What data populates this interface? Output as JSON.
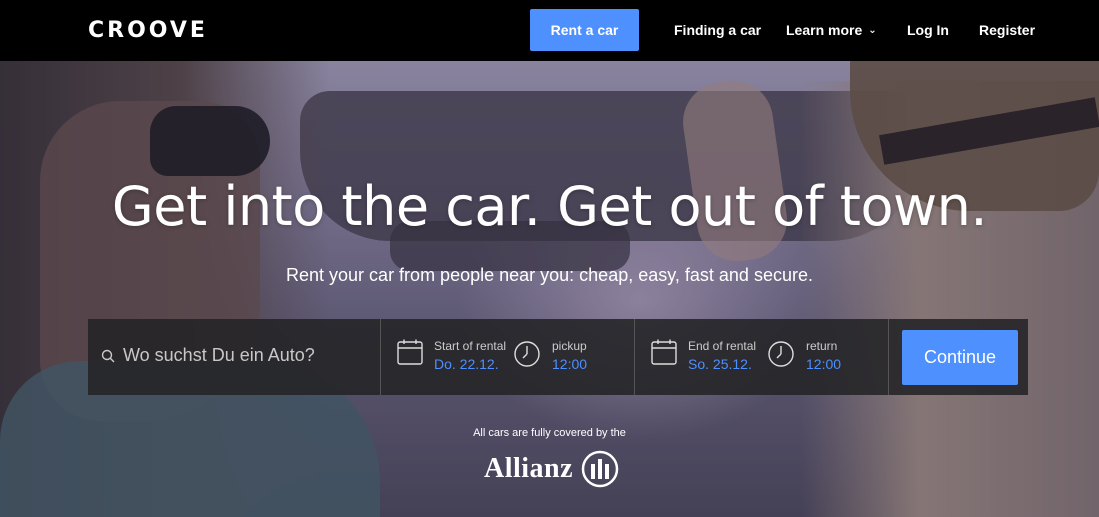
{
  "brand": {
    "logo": "CROOVE"
  },
  "nav": {
    "rent_label": "Rent a car",
    "finding_label": "Finding a car",
    "learn_label": "Learn more",
    "login_label": "Log In",
    "register_label": "Register"
  },
  "hero": {
    "headline": "Get into the car. Get out of town.",
    "subline": "Rent your car from people near you: cheap, easy, fast and secure."
  },
  "search": {
    "placeholder": "Wo suchst Du ein Auto?",
    "start_label": "Start of rental",
    "start_date": "Do. 22.12.",
    "pickup_label": "pickup",
    "pickup_time": "12:00",
    "end_label": "End of rental",
    "end_date": "So. 25.12.",
    "return_label": "return",
    "return_time": "12:00",
    "continue_label": "Continue"
  },
  "insurance": {
    "note": "All cars are fully covered by the",
    "partner": "Allianz"
  },
  "colors": {
    "accent": "#4d90fe",
    "topbar": "#000000"
  },
  "icons": [
    "search-icon",
    "calendar-icon",
    "clock-icon",
    "chevron-down-icon",
    "allianz-logo-icon"
  ]
}
